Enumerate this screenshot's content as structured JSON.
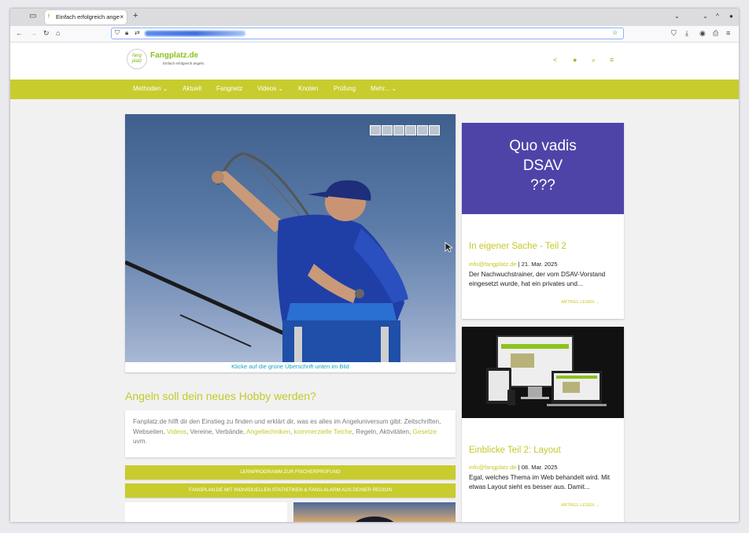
{
  "browser": {
    "tab_title": "Einfach erfolgreich ange",
    "tab_close": "×",
    "new_tab": "+",
    "window_controls": [
      "⌄",
      "⌄",
      "^",
      "●"
    ]
  },
  "site": {
    "logo_text": "fang platz",
    "title": "Fangplatz.de",
    "subtitle": "Einfach erfolgreich angeln.",
    "menu": [
      "Methoden ⌄",
      "Aktuell",
      "Fangnetz",
      "Videos ⌄",
      "Knoten",
      "Prüfung",
      "Mehr... ⌄"
    ]
  },
  "hero": {
    "caption": "Klicke auf die grüne Überschrift unten im Bild"
  },
  "main": {
    "headline": "Angeln soll dein neues Hobby werden?",
    "intro_text_1": "Fanplatz.de hilft dir den Einstieg zu finden und erklärt dir, was es alles im Angeluniversum gibt: Zeitschriften, Webseiten, ",
    "link_videos": "Videos",
    "intro_text_2": ", Vereine, Verbände, ",
    "link_angeltechniken": "Angeltechniken",
    "intro_text_3": ", ",
    "link_teiche": "kommerzielle Teiche",
    "intro_text_4": ", Regeln, Aktivitäten, ",
    "link_gesetze": "Gesetze",
    "intro_text_5": " uvm.",
    "button_1": "Lernprogramm zur Fischerprüfung",
    "button_2": "Fangplan.de mit individuellen Statistiken & Fang-Alarm aus deiner Region"
  },
  "cards": [
    {
      "banner": [
        "Quo vadis",
        "DSAV",
        "???"
      ],
      "title": "In eigener Sache - Teil 2",
      "author": "info@fangplatz.de",
      "date": " | 21. Mar. 2025",
      "excerpt": "Der Nachwuchstrainer, der vom DSAV-Vorstand eingesetzt wurde, hat ein privates und...",
      "more": "Artikel lesen →"
    },
    {
      "title": "Einblicke Teil 2: Layout",
      "author": "info@fangplatz.de",
      "date": " | 08. Mar. 2025",
      "excerpt": "Egal, welches Thema im Web behandelt wird. Mit etwas Layout sieht es besser aus. Damit...",
      "more": "Artikel lesen →"
    }
  ]
}
